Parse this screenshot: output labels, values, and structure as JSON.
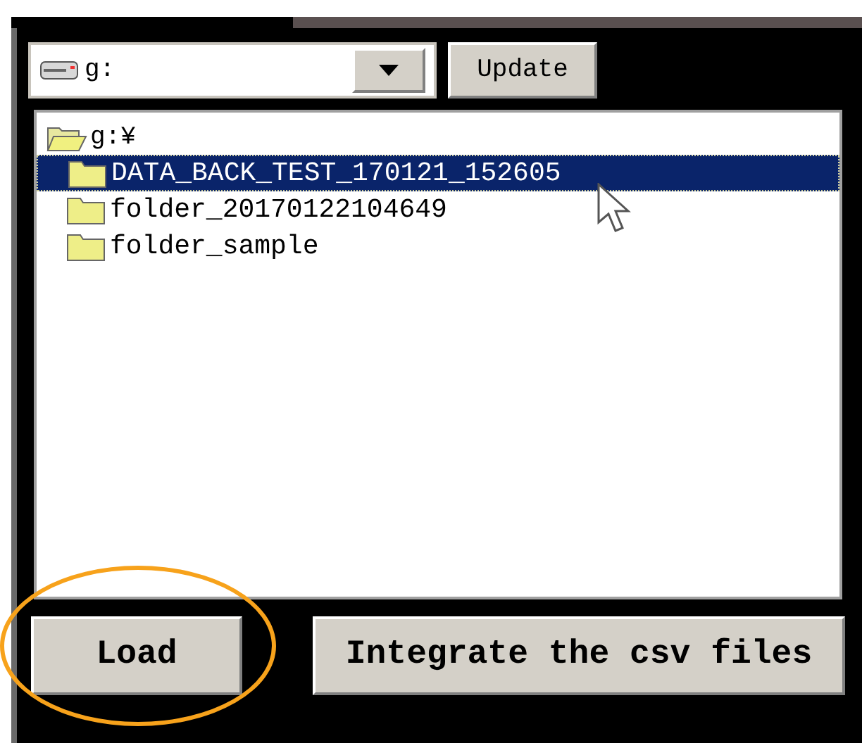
{
  "drive_combo": {
    "value": "g:"
  },
  "update_button": "Update",
  "tree": {
    "label": "g:¥",
    "children": [
      {
        "label": "DATA_BACK_TEST_170121_152605",
        "selected": true
      },
      {
        "label": "folder_20170122104649",
        "selected": false
      },
      {
        "label": "folder_sample",
        "selected": false
      }
    ]
  },
  "buttons": [
    {
      "label": "Load"
    },
    {
      "label": "Integrate the csv files"
    }
  ],
  "annotation": {
    "kind": "ellipse",
    "color": "#f7a21b"
  }
}
